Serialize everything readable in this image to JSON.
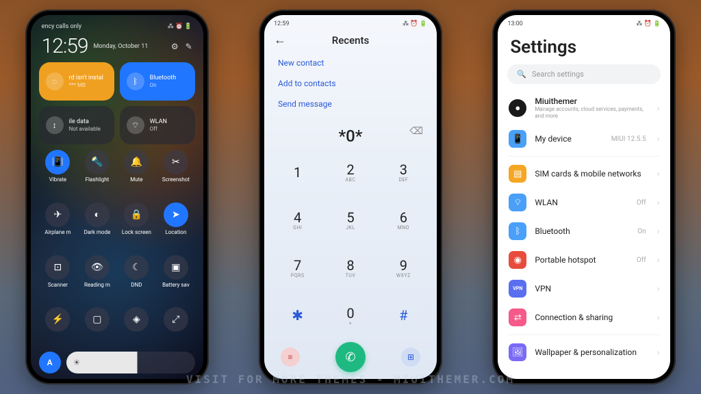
{
  "watermark": "VISIT FOR MORE THEMES - MIUITHEMER.COM",
  "phone1": {
    "carrier": "ency calls only",
    "status_icons": "⁂ ⏰ 🔋",
    "clock": "12:59",
    "date": "Monday, October 11",
    "tiles": [
      {
        "title": "rd isn't instal",
        "sub": "*** MB",
        "icon": "◌",
        "color": "orange"
      },
      {
        "title": "Bluetooth",
        "sub": "On",
        "icon": "ᛒ",
        "color": "blue"
      },
      {
        "title": "ile data",
        "sub": "Not available",
        "icon": "↕",
        "color": "dark"
      },
      {
        "title": "WLAN",
        "sub": "Off",
        "icon": "⌔",
        "color": "dark"
      }
    ],
    "toggles": [
      {
        "label": "Vibrate",
        "icon": "📳",
        "active": true
      },
      {
        "label": "Flashlight",
        "icon": "🔦",
        "active": false
      },
      {
        "label": "Mute",
        "icon": "🔔",
        "active": false
      },
      {
        "label": "Screenshot",
        "icon": "✂",
        "active": false
      },
      {
        "label": "Airplane m",
        "icon": "✈",
        "active": false
      },
      {
        "label": "Dark mode",
        "icon": "◐",
        "active": false
      },
      {
        "label": "Lock screen",
        "icon": "🔒",
        "active": false
      },
      {
        "label": "Location",
        "icon": "➤",
        "active": true
      },
      {
        "label": "Scanner",
        "icon": "⊡",
        "active": false
      },
      {
        "label": "Reading m",
        "icon": "👁",
        "active": false
      },
      {
        "label": "DND",
        "icon": "☾",
        "active": false
      },
      {
        "label": "Battery sav",
        "icon": "▣",
        "active": false
      },
      {
        "label": "",
        "icon": "⚡",
        "active": false
      },
      {
        "label": "",
        "icon": "▢",
        "active": false
      },
      {
        "label": "",
        "icon": "◈",
        "active": false
      },
      {
        "label": "",
        "icon": "⤢",
        "active": false
      }
    ],
    "auto_label": "A"
  },
  "phone2": {
    "time": "12:59",
    "title": "Recents",
    "links": [
      "New contact",
      "Add to contacts",
      "Send message"
    ],
    "display": "*0*",
    "keys": [
      {
        "n": "1",
        "s": ""
      },
      {
        "n": "2",
        "s": "ABC"
      },
      {
        "n": "3",
        "s": "DEF"
      },
      {
        "n": "4",
        "s": "GHI"
      },
      {
        "n": "5",
        "s": "JKL"
      },
      {
        "n": "6",
        "s": "MNO"
      },
      {
        "n": "7",
        "s": "PQRS"
      },
      {
        "n": "8",
        "s": "TUV"
      },
      {
        "n": "9",
        "s": "WXYZ"
      },
      {
        "n": "✱",
        "s": ""
      },
      {
        "n": "0",
        "s": "+"
      },
      {
        "n": "#",
        "s": ""
      }
    ]
  },
  "phone3": {
    "time": "13:00",
    "title": "Settings",
    "search_placeholder": "Search settings",
    "account": {
      "name": "Miuithemer",
      "sub": "Manage accounts, cloud services, payments, and more"
    },
    "rows": [
      {
        "icon": "device",
        "label": "My device",
        "value": "MIUI 12.5.5"
      },
      {
        "divider": true
      },
      {
        "icon": "sim",
        "label": "SIM cards & mobile networks",
        "value": ""
      },
      {
        "icon": "wlan",
        "label": "WLAN",
        "value": "Off"
      },
      {
        "icon": "bt",
        "label": "Bluetooth",
        "value": "On"
      },
      {
        "icon": "hotspot",
        "label": "Portable hotspot",
        "value": "Off"
      },
      {
        "icon": "vpn",
        "label": "VPN",
        "value": ""
      },
      {
        "icon": "share",
        "label": "Connection & sharing",
        "value": ""
      },
      {
        "divider": true
      },
      {
        "icon": "wall",
        "label": "Wallpaper & personalization",
        "value": ""
      }
    ]
  }
}
